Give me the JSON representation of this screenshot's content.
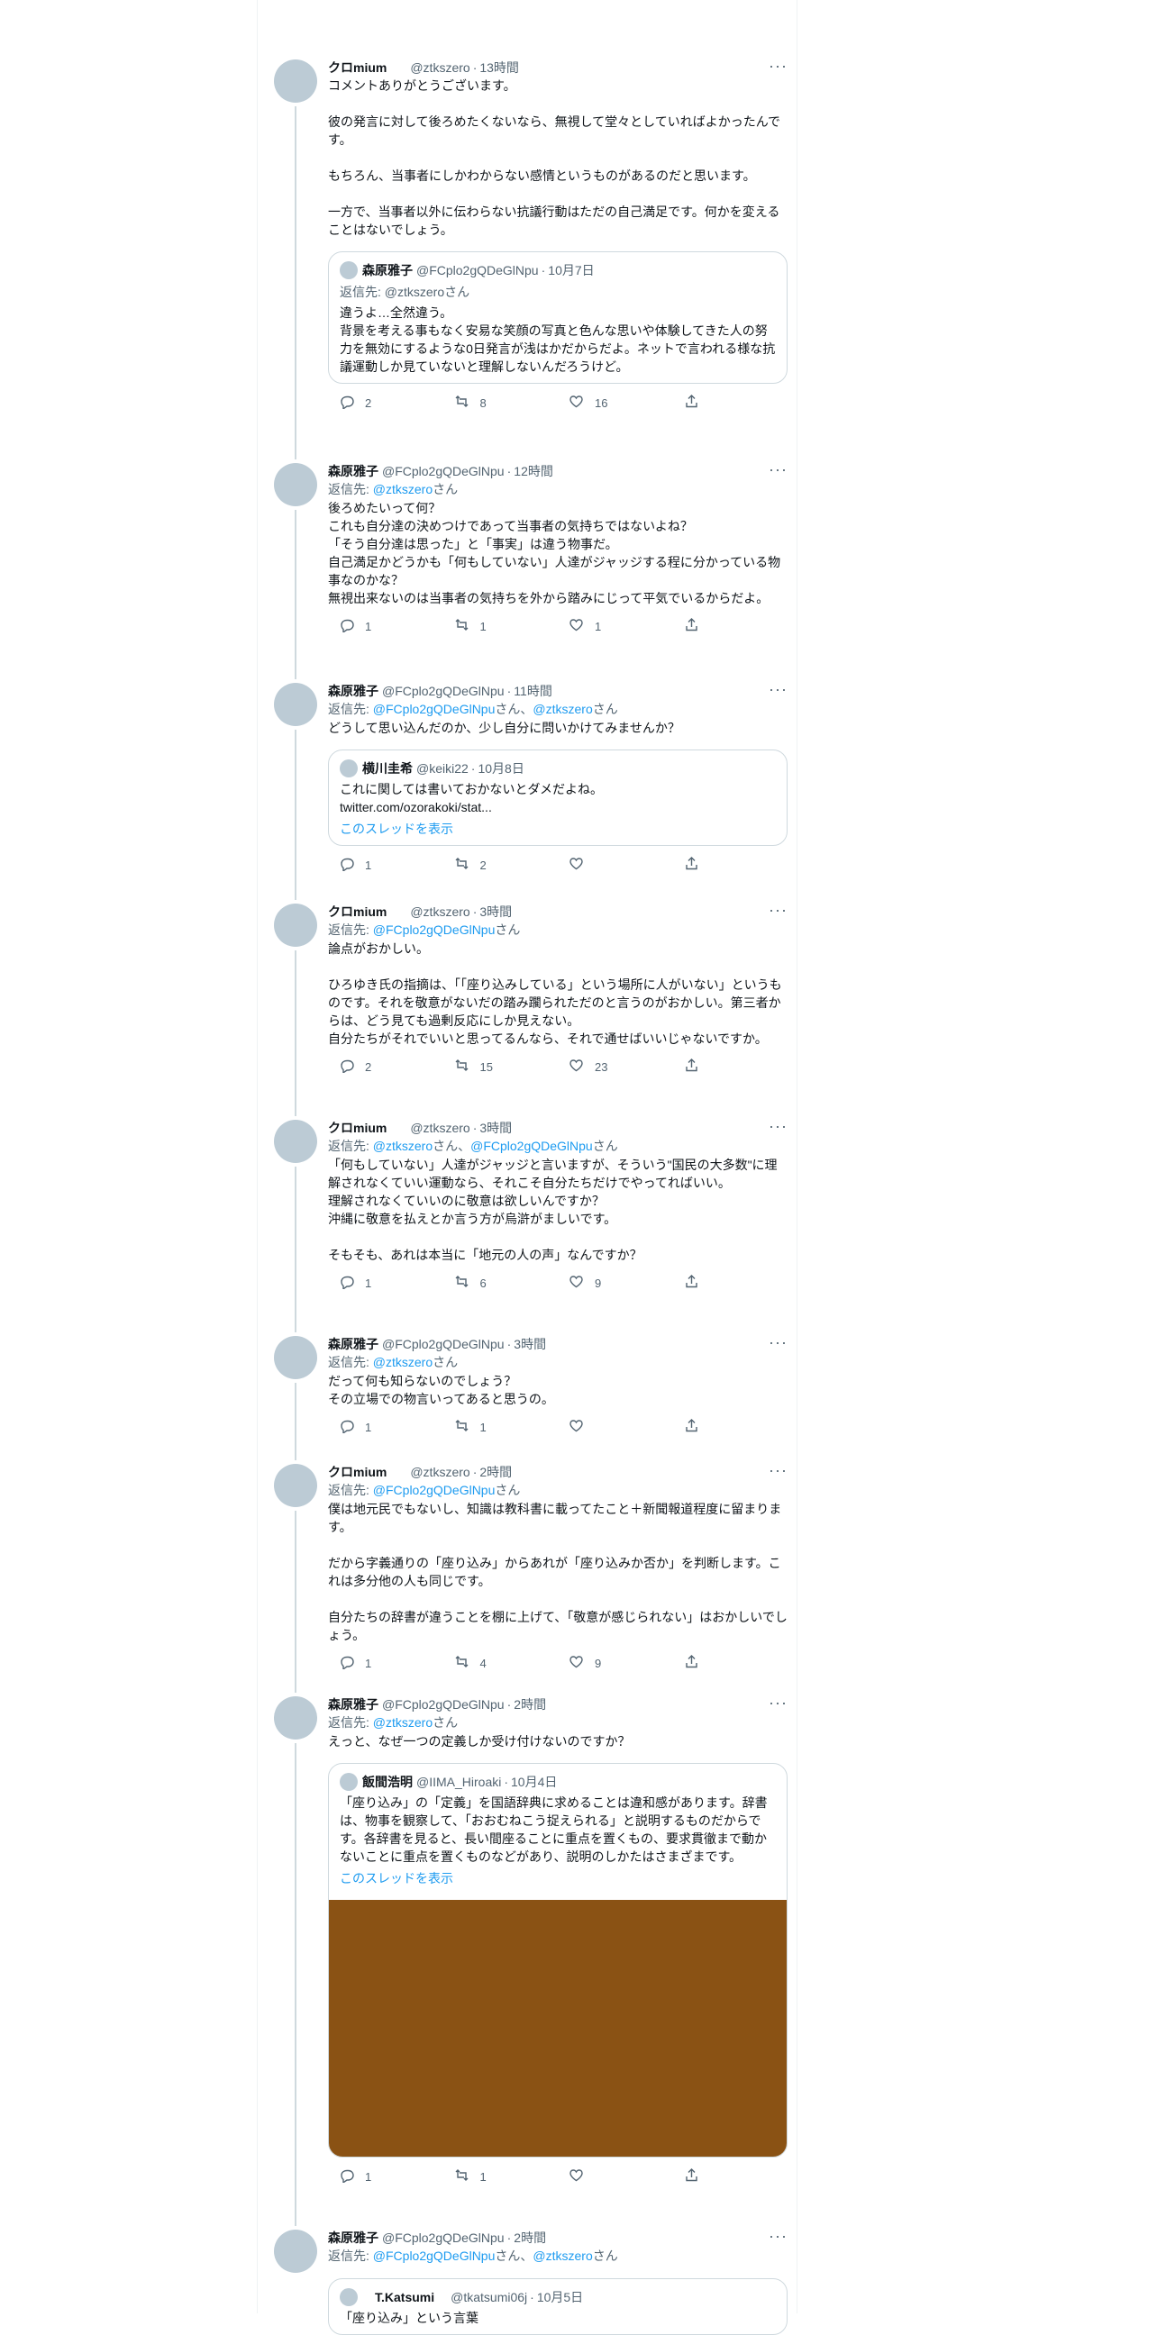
{
  "tweets": [
    {
      "name": "クロmium",
      "handle": "@ztkszero",
      "time": "13時間",
      "text": "コメントありがとうございます。\n\n彼の発言に対して後ろめたくないなら、無視して堂々としていればよかったんです。\n\nもちろん、当事者にしかわからない感情というものがあるのだと思います。\n\n一方で、当事者以外に伝わらない抗議行動はただの自己満足です。何かを変えることはないでしょう。",
      "quote": {
        "name": "森原雅子",
        "handle": "@FCplo2gQDeGlNpu",
        "date": "10月7日",
        "reply": "返信先: @ztkszeroさん",
        "text": "違うよ…全然違う。\n背景を考える事もなく安易な笑顔の写真と色んな思いや体験してきた人の努力を無効にするような0日発言が浅はかだからだよ。ネットで言われる様な抗議運動しか見ていないと理解しないんだろうけど。"
      },
      "stats": {
        "reply": "2",
        "retweet": "8",
        "like": "16"
      }
    },
    {
      "name": "森原雅子",
      "handle": "@FCplo2gQDeGlNpu",
      "time": "12時間",
      "reply_prefix": "返信先: ",
      "reply_to": [
        "@ztkszero"
      ],
      "text": "後ろめたいって何？\nこれも自分達の決めつけであって当事者の気持ちではないよね？\n「そう自分達は思った」と「事実」は違う物事だ。\n自己満足かどうかも「何もしていない」人達がジャッジする程に分かっている物事なのかな？\n無視出来ないのは当事者の気持ちを外から踏みにじって平気でいるからだよ。",
      "stats": {
        "reply": "1",
        "retweet": "1",
        "like": "1"
      }
    },
    {
      "name": "森原雅子",
      "handle": "@FCplo2gQDeGlNpu",
      "time": "11時間",
      "reply_prefix": "返信先: ",
      "reply_to": [
        "@FCplo2gQDeGlNpu",
        "@ztkszero"
      ],
      "text": "どうして思い込んだのか、少し自分に問いかけてみませんか？",
      "quote": {
        "name": "横川圭希",
        "handle": "@keiki22",
        "date": "10月8日",
        "text": "これに関しては書いておかないとダメだよね。\ntwitter.com/ozorakoki/stat...",
        "link": "このスレッドを表示"
      },
      "stats": {
        "reply": "1",
        "retweet": "2",
        "like": ""
      }
    },
    {
      "name": "クロmium",
      "handle": "@ztkszero",
      "time": "3時間",
      "reply_prefix": "返信先: ",
      "reply_to": [
        "@FCplo2gQDeGlNpu"
      ],
      "text": "論点がおかしい。\n\nひろゆき氏の指摘は、「「座り込みしている」という場所に人がいない」というものです。それを敬意がないだの踏み躙られただのと言うのがおかしい。第三者からは、どう見ても過剰反応にしか見えない。\n自分たちがそれでいいと思ってるんなら、それで通せばいいじゃないですか。",
      "stats": {
        "reply": "2",
        "retweet": "15",
        "like": "23"
      }
    },
    {
      "name": "クロmium",
      "handle": "@ztkszero",
      "time": "3時間",
      "reply_prefix": "返信先: ",
      "reply_to": [
        "@ztkszero",
        "@FCplo2gQDeGlNpu"
      ],
      "text": "「何もしていない」人達がジャッジと言いますが、そういう\"国民の大多数\"に理解されなくていい運動なら、それこそ自分たちだけでやってればいい。\n理解されなくていいのに敬意は欲しいんですか？\n沖縄に敬意を払えとか言う方が烏滸がましいです。\n\nそもそも、あれは本当に「地元の人の声」なんですか？",
      "stats": {
        "reply": "1",
        "retweet": "6",
        "like": "9"
      }
    },
    {
      "name": "森原雅子",
      "handle": "@FCplo2gQDeGlNpu",
      "time": "3時間",
      "reply_prefix": "返信先: ",
      "reply_to": [
        "@ztkszero"
      ],
      "text": "だって何も知らないのでしょう？\nその立場での物言いってあると思うの。",
      "stats": {
        "reply": "1",
        "retweet": "1",
        "like": ""
      }
    },
    {
      "name": "クロmium",
      "handle": "@ztkszero",
      "time": "2時間",
      "reply_prefix": "返信先: ",
      "reply_to": [
        "@FCplo2gQDeGlNpu"
      ],
      "text": "僕は地元民でもないし、知識は教科書に載ってたこと＋新聞報道程度に留まります。\n\nだから字義通りの「座り込み」からあれが「座り込みか否か」を判断します。これは多分他の人も同じです。\n\n自分たちの辞書が違うことを棚に上げて、「敬意が感じられない」はおかしいでしょう。",
      "stats": {
        "reply": "1",
        "retweet": "4",
        "like": "9"
      }
    },
    {
      "name": "森原雅子",
      "handle": "@FCplo2gQDeGlNpu",
      "time": "2時間",
      "reply_prefix": "返信先: ",
      "reply_to": [
        "@ztkszero"
      ],
      "text": "えっと、なぜ一つの定義しか受け付けないのですか？",
      "quote": {
        "name": "飯間浩明",
        "handle": "@IIMA_Hiroaki",
        "date": "10月4日",
        "text": "「座り込み」の「定義」を国語辞典に求めることは違和感があります。辞書は、物事を観察して、「おおむねこう捉えられる」と説明するものだからです。各辞書を見ると、長い間座ることに重点を置くもの、要求貫徹まで動かないことに重点を置くものなどがあり、説明のしかたはさまざまです。",
        "link": "このスレッドを表示",
        "image": true
      },
      "stats": {
        "reply": "1",
        "retweet": "1",
        "like": ""
      }
    },
    {
      "name": "森原雅子",
      "handle": "@FCplo2gQDeGlNpu",
      "time": "2時間",
      "reply_prefix": "返信先: ",
      "reply_to": [
        "@FCplo2gQDeGlNpu",
        "@ztkszero"
      ],
      "text": "",
      "quote": {
        "name": "T.Katsumi",
        "handle": "@tkatsumi06j",
        "date": "10月5日",
        "text": "「座り込み」という言葉"
      }
    }
  ],
  "reply_suffix": "さん",
  "reply_sep": "、",
  "icons": {
    "reply": "reply-icon",
    "retweet": "retweet-icon",
    "like": "like-icon",
    "share": "share-icon",
    "more": "more-icon"
  }
}
